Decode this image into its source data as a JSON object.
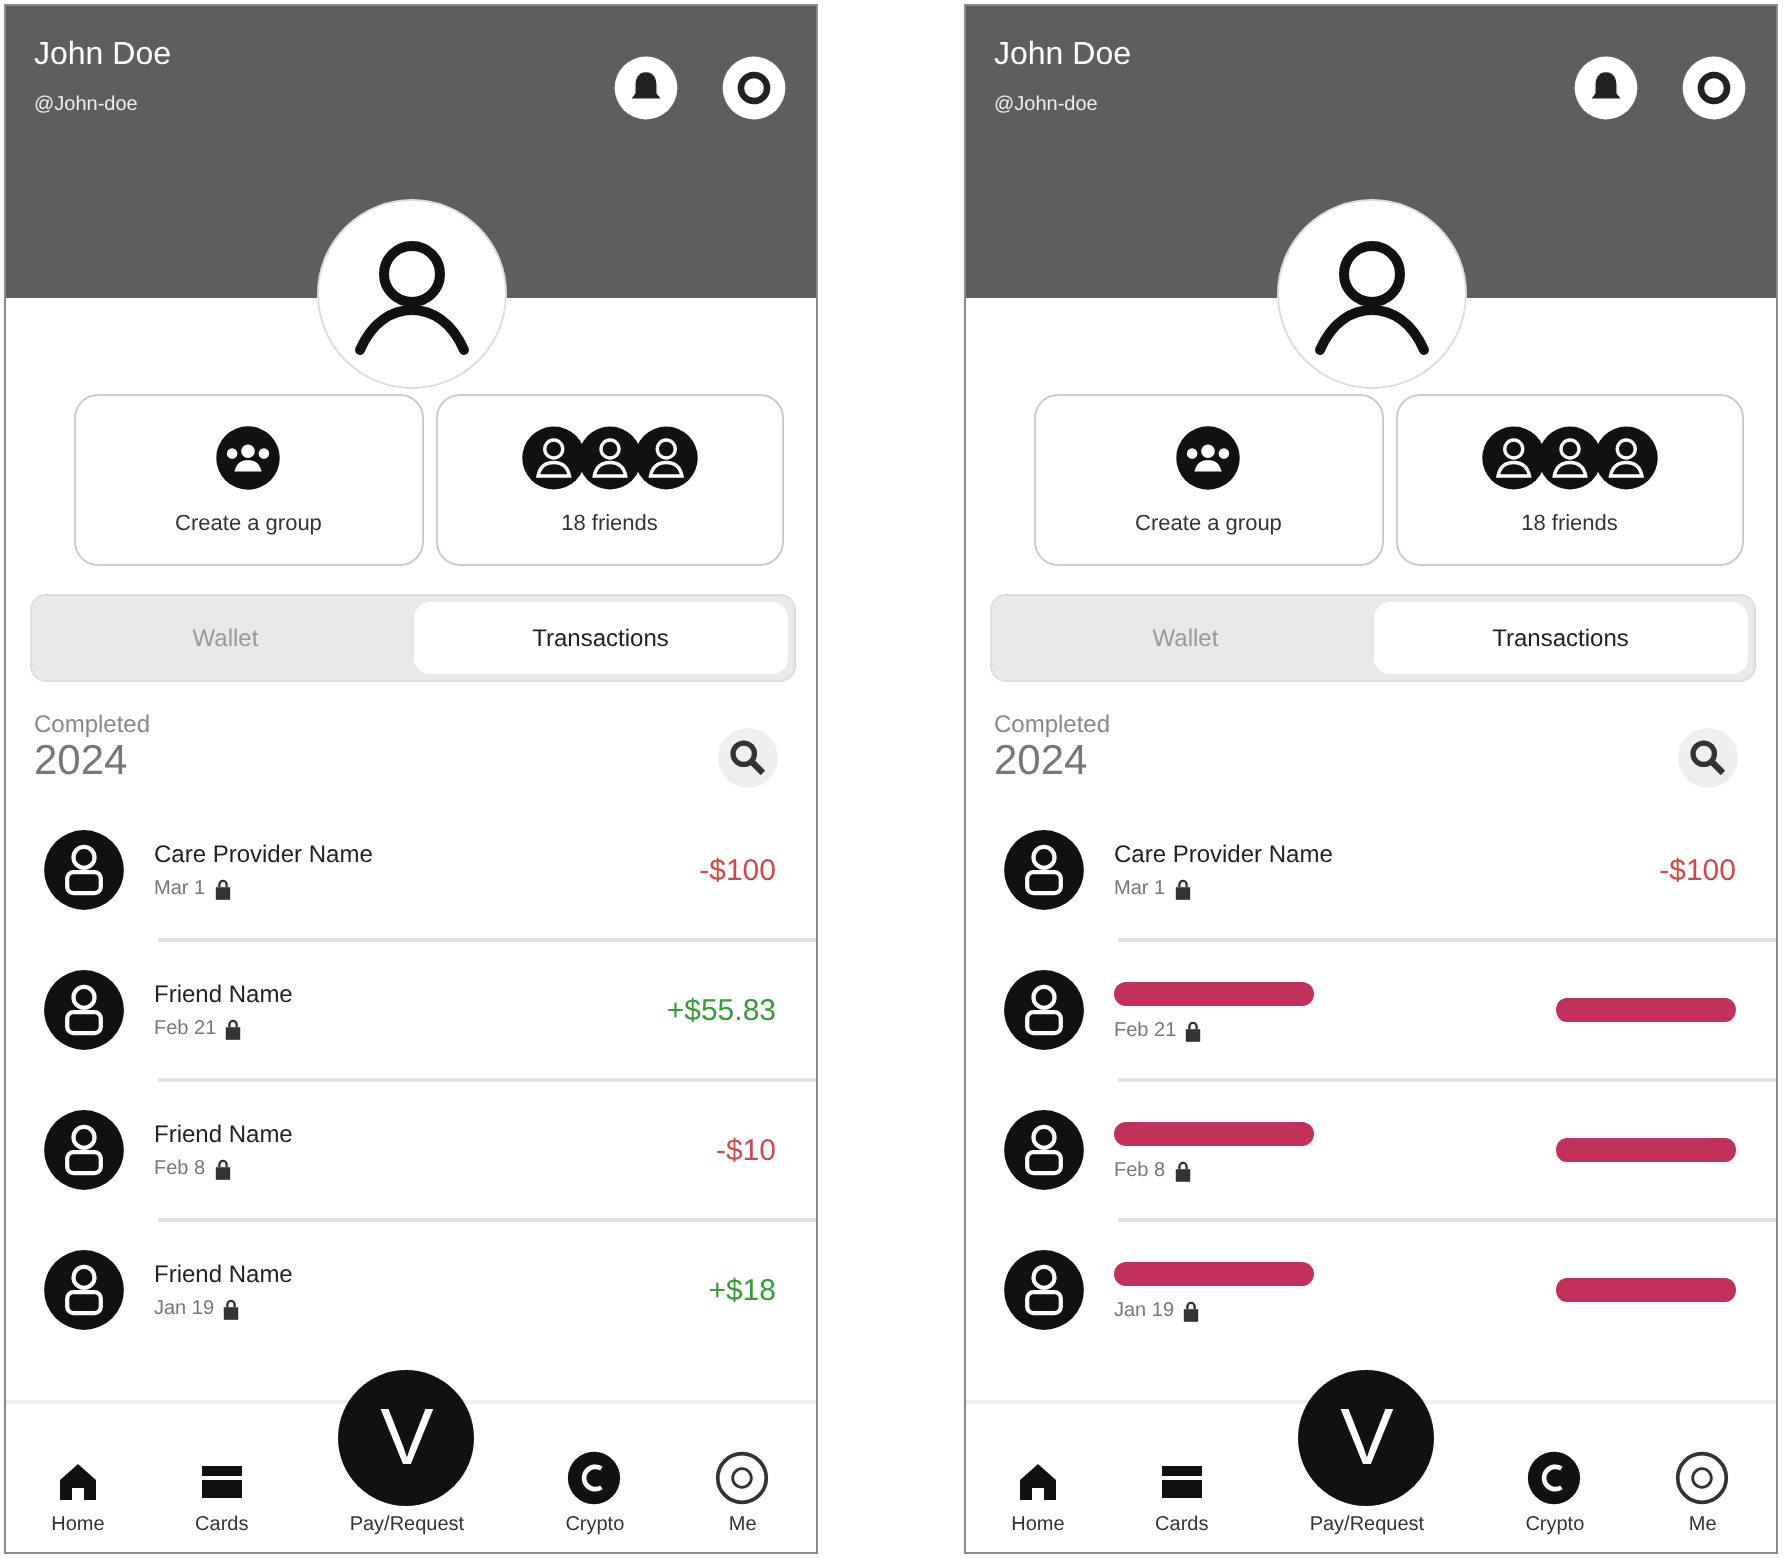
{
  "screens": [
    {
      "profile": {
        "name": "John Doe",
        "handle": "@John-doe"
      },
      "actions": [
        {
          "kind": "group",
          "label": "Create a group"
        },
        {
          "kind": "friends",
          "label": "18 friends"
        }
      ],
      "tabs": [
        {
          "label": "Wallet",
          "selected": false
        },
        {
          "label": "Transactions",
          "selected": true
        }
      ],
      "section": {
        "status": "Completed",
        "year": "2024"
      },
      "transactions": [
        {
          "redacted": false,
          "name": "Care Provider Name",
          "date": "Mar 1",
          "amount": "-$100",
          "kind": "debit"
        },
        {
          "redacted": false,
          "name": "Friend Name",
          "date": "Feb 21",
          "amount": "+$55.83",
          "kind": "credit"
        },
        {
          "redacted": false,
          "name": "Friend Name",
          "date": "Feb 8",
          "amount": "-$10",
          "kind": "debit"
        },
        {
          "redacted": false,
          "name": "Friend Name",
          "date": "Jan 19",
          "amount": "+$18",
          "kind": "credit"
        }
      ],
      "nav": [
        {
          "kind": "home",
          "label": "Home"
        },
        {
          "kind": "cards",
          "label": "Cards"
        },
        {
          "kind": "pay",
          "label": "Pay/Request",
          "glyph": "V"
        },
        {
          "kind": "crypto",
          "label": "Crypto"
        },
        {
          "kind": "me",
          "label": "Me"
        }
      ]
    },
    {
      "profile": {
        "name": "John Doe",
        "handle": "@John-doe"
      },
      "actions": [
        {
          "kind": "group",
          "label": "Create a group"
        },
        {
          "kind": "friends",
          "label": "18 friends"
        }
      ],
      "tabs": [
        {
          "label": "Wallet",
          "selected": false
        },
        {
          "label": "Transactions",
          "selected": true
        }
      ],
      "section": {
        "status": "Completed",
        "year": "2024"
      },
      "transactions": [
        {
          "redacted": false,
          "name": "Care Provider Name",
          "date": "Mar 1",
          "amount": "-$100",
          "kind": "debit"
        },
        {
          "redacted": true,
          "date": "Feb 21"
        },
        {
          "redacted": true,
          "date": "Feb 8"
        },
        {
          "redacted": true,
          "date": "Jan 19"
        }
      ],
      "nav": [
        {
          "kind": "home",
          "label": "Home"
        },
        {
          "kind": "cards",
          "label": "Cards"
        },
        {
          "kind": "pay",
          "label": "Pay/Request",
          "glyph": "V"
        },
        {
          "kind": "crypto",
          "label": "Crypto"
        },
        {
          "kind": "me",
          "label": "Me"
        }
      ]
    }
  ]
}
